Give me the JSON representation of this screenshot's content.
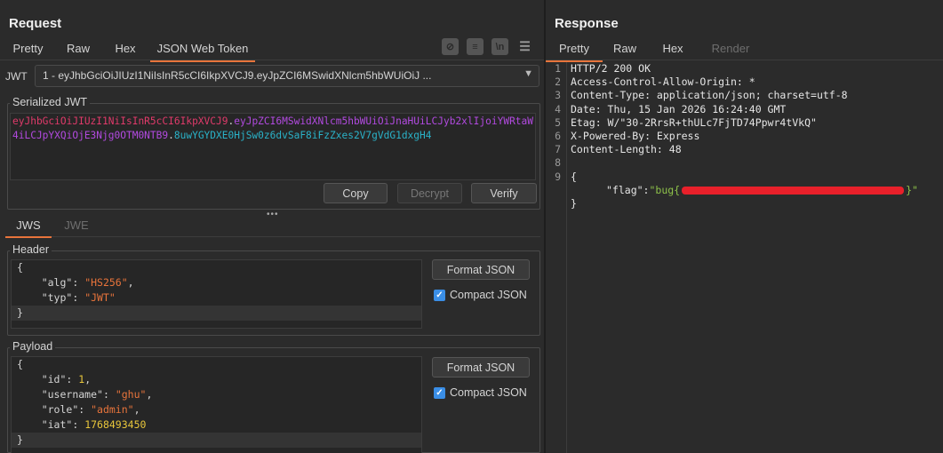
{
  "request": {
    "title": "Request",
    "tabs": [
      "Pretty",
      "Raw",
      "Hex",
      "JSON Web Token"
    ],
    "active_tab": "JSON Web Token",
    "toolbar_icons": [
      "hide-icon",
      "wrap-icon",
      "newline-icon",
      "menu-icon"
    ],
    "jwt_label": "JWT",
    "jwt_selected": "1 - eyJhbGciOiJIUzI1NiIsInR5cCI6IkpXVCJ9.eyJpZCI6MSwidXNlcm5hbWUiOiJ ...",
    "serialized": {
      "legend": "Serialized JWT",
      "header_part": "eyJhbGciOiJIUzI1NiIsInR5cCI6IkpXVCJ9",
      "payload_part": "eyJpZCI6MSwidXNlcm5hbWUiOiJnaHUiLCJyb2xlIjoiYWRtaW4iLCJpYXQiOjE3Njg0OTM0NTB9",
      "signature_part": "8uwYGYDXE0HjSw0z6dvSaF8iFzZxes2V7gVdG1dxgH4",
      "dot": ".",
      "buttons": {
        "copy": "Copy",
        "decrypt": "Decrypt",
        "verify": "Verify"
      }
    },
    "sub_tabs": [
      "JWS",
      "JWE"
    ],
    "header": {
      "legend": "Header",
      "format_label": "Format JSON",
      "compact_label": "Compact JSON",
      "compact_checked": true,
      "lines": [
        {
          "open": "{"
        },
        {
          "key": "\"alg\"",
          "colon": ": ",
          "value": "\"HS256\"",
          "type": "s",
          "comma": ","
        },
        {
          "key": "\"typ\"",
          "colon": ": ",
          "value": "\"JWT\"",
          "type": "s",
          "comma": ""
        },
        {
          "close": "}"
        }
      ]
    },
    "payload": {
      "legend": "Payload",
      "format_label": "Format JSON",
      "compact_label": "Compact JSON",
      "compact_checked": true,
      "lines": [
        {
          "open": "{"
        },
        {
          "key": "\"id\"",
          "colon": ": ",
          "value": "1",
          "type": "n",
          "comma": ","
        },
        {
          "key": "\"username\"",
          "colon": ": ",
          "value": "\"ghu\"",
          "type": "s",
          "comma": ","
        },
        {
          "key": "\"role\"",
          "colon": ": ",
          "value": "\"admin\"",
          "type": "s",
          "comma": ","
        },
        {
          "key": "\"iat\"",
          "colon": ": ",
          "value": "1768493450",
          "type": "n",
          "comma": ""
        },
        {
          "close": "}"
        }
      ]
    }
  },
  "response": {
    "title": "Response",
    "tabs": [
      "Pretty",
      "Raw",
      "Hex",
      "Render"
    ],
    "active_tab": "Pretty",
    "line_numbers": [
      "1",
      "2",
      "3",
      "4",
      "5",
      "6",
      "7",
      "8",
      "9"
    ],
    "lines": [
      "HTTP/2 200 OK",
      "Access-Control-Allow-Origin: *",
      "Content-Type: application/json; charset=utf-8",
      "Date: Thu, 15 Jan 2026 16:24:40 GMT",
      "Etag: W/\"30-2RrsR+thULc7FjTD74Ppwr4tVkQ\"",
      "X-Powered-By: Express",
      "Content-Length: 48",
      "",
      "{"
    ],
    "flag_key": "\"flag\"",
    "flag_colon": ":",
    "flag_prefix": "\"bug{",
    "flag_suffix": "}\"",
    "close_brace": "}"
  },
  "colors": {
    "accent": "#e8743b",
    "redaction": "#e8202a"
  }
}
